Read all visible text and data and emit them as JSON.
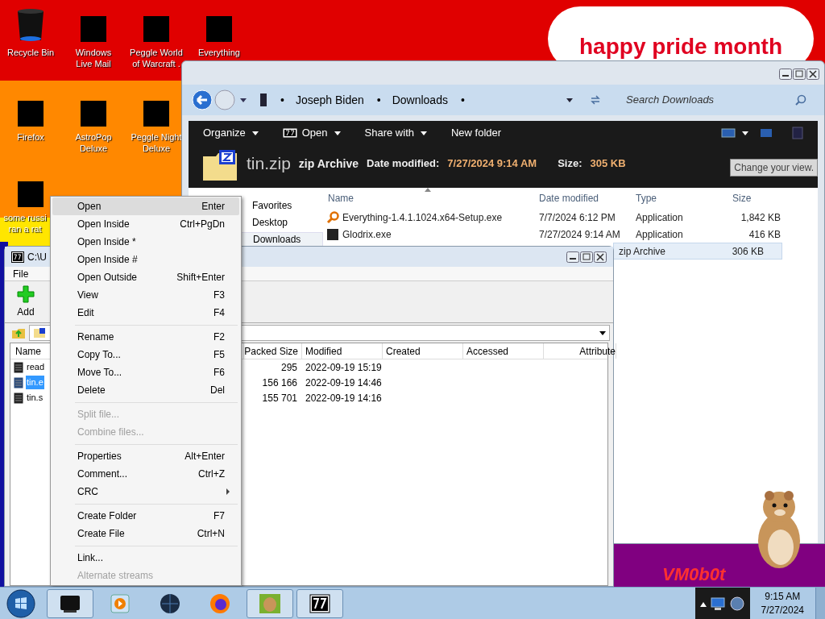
{
  "desktop": {
    "wallpaper_text": "happy pride month",
    "wallpaper_logo": "VM0b0t",
    "icons": [
      {
        "label": "Recycle Bin",
        "kind": "bin"
      },
      {
        "label": "Windows Live Mail",
        "kind": "redacted"
      },
      {
        "label": "Peggle World of Warcraft .",
        "kind": "redacted"
      },
      {
        "label": "Everything",
        "kind": "redacted"
      },
      {
        "label": "Firefox",
        "kind": "redacted"
      },
      {
        "label": "AstroPop Deluxe",
        "kind": "redacted"
      },
      {
        "label": "Peggle Night Deluxe",
        "kind": "redacted"
      },
      {
        "label": "some russi ran a rat",
        "kind": "redacted"
      }
    ]
  },
  "explorer": {
    "breadcrumb": [
      "Joseph Biden",
      "Downloads"
    ],
    "breadcrumb_separator": "•",
    "search": {
      "placeholder": "Search Downloads"
    },
    "commands": [
      {
        "label": "Organize",
        "dropdown": true,
        "kind": "plain"
      },
      {
        "label": "Open",
        "dropdown": true,
        "kind": "sevenzip"
      },
      {
        "label": "Share with",
        "dropdown": true,
        "kind": "plain"
      },
      {
        "label": "New folder",
        "dropdown": false,
        "kind": "plain"
      }
    ],
    "details": {
      "name": "tin.zip",
      "type": "zip Archive",
      "date_label": "Date modified:",
      "date": "7/27/2024 9:14 AM",
      "size_label": "Size:",
      "size": "305 KB"
    },
    "tooltip": "Change your view.",
    "nav": [
      {
        "label": "Favorites",
        "selected": false
      },
      {
        "label": "Desktop",
        "selected": false
      },
      {
        "label": "Downloads",
        "selected": true
      }
    ],
    "columns": [
      "Name",
      "Date modified",
      "Type",
      "Size"
    ],
    "rows": [
      {
        "name": "Everything-1.4.1.1024.x64-Setup.exe",
        "date": "7/7/2024 6:12 PM",
        "type": "Application",
        "size": "1,842 KB",
        "kind": "search",
        "selected": false
      },
      {
        "name": "Glodrix.exe",
        "date": "7/27/2024 9:14 AM",
        "type": "Application",
        "size": "416 KB",
        "kind": "app",
        "selected": false
      },
      {
        "type": "zip Archive",
        "size": "306 KB",
        "selected": true
      }
    ]
  },
  "sevenzip": {
    "title": "C:\\U",
    "menu": [
      "File"
    ],
    "toolbar": [
      {
        "label": "Add",
        "kind": "add"
      }
    ],
    "columns": [
      "Name",
      "Packed Size",
      "Modified",
      "Created",
      "Accessed",
      "Attribute"
    ],
    "rows": [
      {
        "name": "read",
        "packed": "295",
        "modified": "2022-09-19 15:19",
        "selected": false
      },
      {
        "name": "tin.e",
        "packed": "156 166",
        "modified": "2022-09-19 14:46",
        "selected": true
      },
      {
        "name": "tin.s",
        "packed": "155 701",
        "modified": "2022-09-19 14:16",
        "selected": false
      }
    ]
  },
  "context_menu": {
    "items": [
      {
        "kind": "item",
        "label": "Open",
        "shortcut": "Enter",
        "disabled": false,
        "selected": true
      },
      {
        "kind": "item",
        "label": "Open Inside",
        "shortcut": "Ctrl+PgDn",
        "disabled": false,
        "selected": false
      },
      {
        "kind": "item",
        "label": "Open Inside *",
        "disabled": false,
        "selected": false
      },
      {
        "kind": "item",
        "label": "Open Inside #",
        "disabled": false,
        "selected": false
      },
      {
        "kind": "item",
        "label": "Open Outside",
        "shortcut": "Shift+Enter",
        "disabled": false,
        "selected": false
      },
      {
        "kind": "item",
        "label": "View",
        "shortcut": "F3",
        "disabled": false,
        "selected": false
      },
      {
        "kind": "item",
        "label": "Edit",
        "shortcut": "F4",
        "disabled": false,
        "selected": false
      },
      {
        "kind": "separator"
      },
      {
        "kind": "item",
        "label": "Rename",
        "shortcut": "F2",
        "disabled": false,
        "selected": false
      },
      {
        "kind": "item",
        "label": "Copy To...",
        "shortcut": "F5",
        "disabled": false,
        "selected": false
      },
      {
        "kind": "item",
        "label": "Move To...",
        "shortcut": "F6",
        "disabled": false,
        "selected": false
      },
      {
        "kind": "item",
        "label": "Delete",
        "shortcut": "Del",
        "disabled": false,
        "selected": false
      },
      {
        "kind": "separator"
      },
      {
        "kind": "item",
        "label": "Split file...",
        "disabled": true,
        "selected": false
      },
      {
        "kind": "item",
        "label": "Combine files...",
        "disabled": true,
        "selected": false
      },
      {
        "kind": "separator"
      },
      {
        "kind": "item",
        "label": "Properties",
        "shortcut": "Alt+Enter",
        "disabled": false,
        "selected": false
      },
      {
        "kind": "item",
        "label": "Comment...",
        "shortcut": "Ctrl+Z",
        "disabled": false,
        "selected": false
      },
      {
        "kind": "item",
        "label": "CRC",
        "submenu": true,
        "disabled": false,
        "selected": false
      },
      {
        "kind": "separator"
      },
      {
        "kind": "item",
        "label": "Create Folder",
        "shortcut": "F7",
        "disabled": false,
        "selected": false
      },
      {
        "kind": "item",
        "label": "Create File",
        "shortcut": "Ctrl+N",
        "disabled": false,
        "selected": false
      },
      {
        "kind": "separator"
      },
      {
        "kind": "item",
        "label": "Link...",
        "disabled": false,
        "selected": false
      },
      {
        "kind": "item",
        "label": "Alternate streams",
        "disabled": true,
        "selected": false
      }
    ]
  },
  "taskbar": {
    "apps": [
      {
        "kind": "monitor",
        "active": true
      },
      {
        "kind": "media",
        "active": false
      },
      {
        "kind": "globe",
        "active": false
      },
      {
        "kind": "firefox",
        "active": false
      },
      {
        "kind": "hamster",
        "active": true
      },
      {
        "kind": "sevenzip",
        "active": true
      }
    ],
    "time": "9:15 AM",
    "date": "7/27/2024"
  }
}
